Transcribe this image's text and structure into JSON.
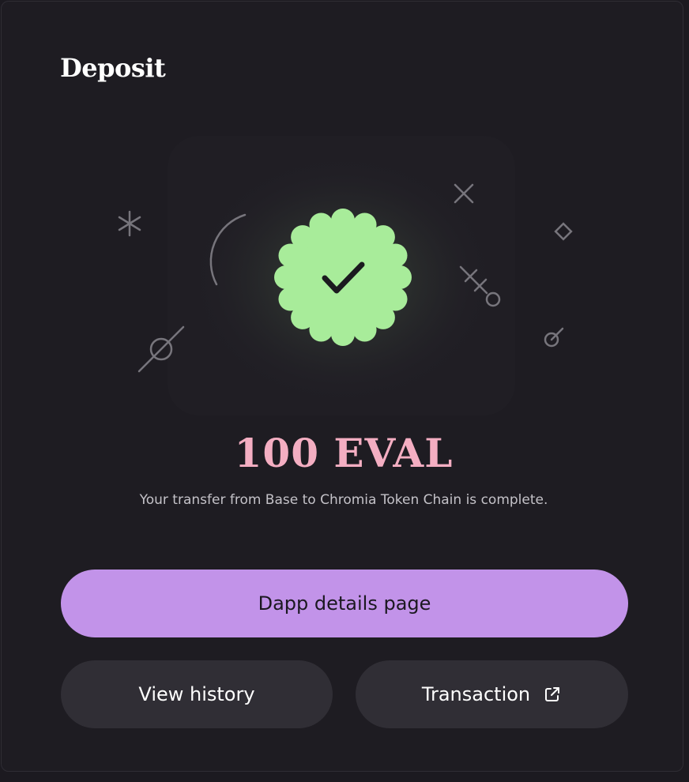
{
  "header": {
    "title": "Deposit"
  },
  "result": {
    "amount": "100 EVAL",
    "message": "Your transfer from Base to Chromia Token Chain is complete."
  },
  "actions": {
    "primary_label": "Dapp details page",
    "history_label": "View history",
    "transaction_label": "Transaction"
  },
  "icons": {
    "success": "check-badge-icon",
    "external": "external-link-icon"
  },
  "colors": {
    "background": "#1e1c22",
    "accent_primary": "#c293e9",
    "success_badge": "#a8ec9a",
    "amount_text": "#f4aec2",
    "secondary_button": "#302e35"
  }
}
